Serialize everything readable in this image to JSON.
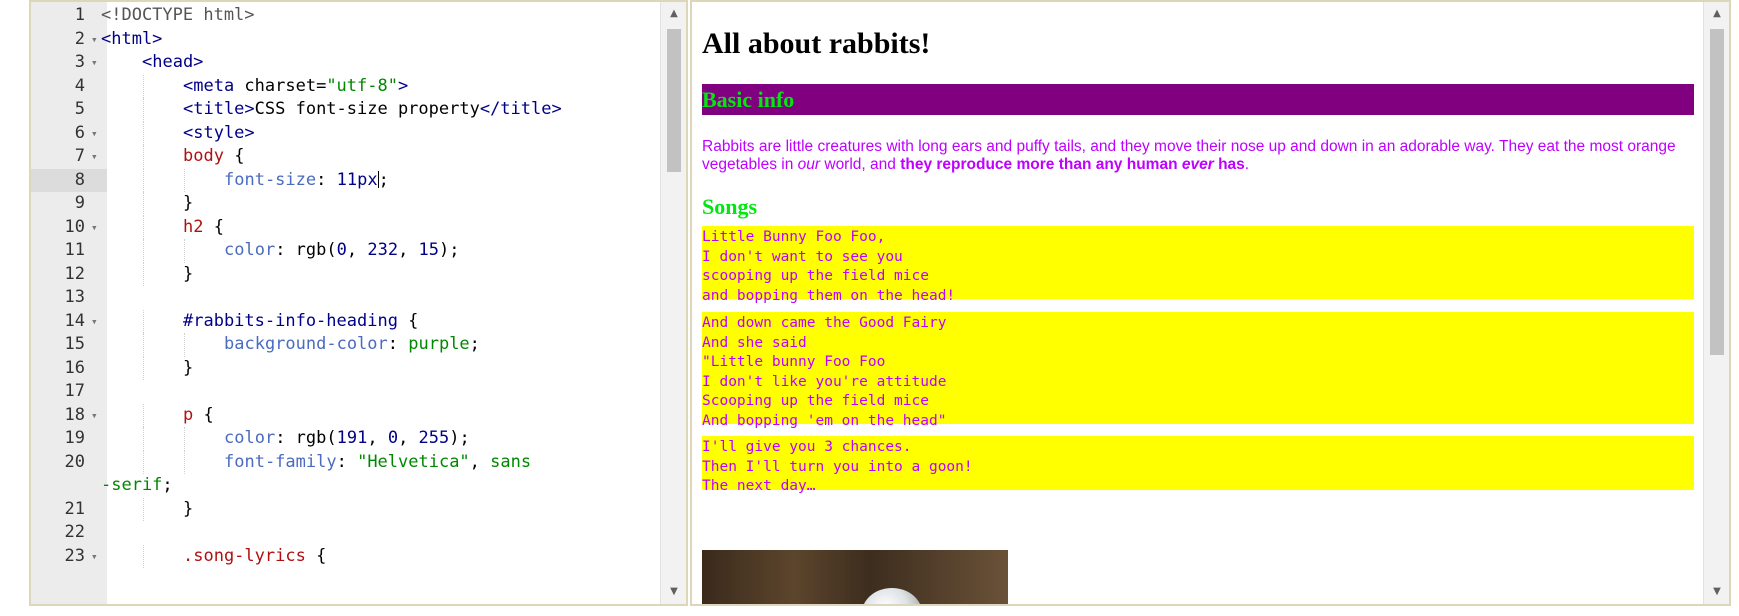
{
  "editor": {
    "active_line": 8,
    "lines": [
      {
        "n": "1",
        "fold": false,
        "indent": 0,
        "parts": [
          {
            "t": "<!DOCTYPE html>",
            "c": "doc"
          }
        ]
      },
      {
        "n": "2",
        "fold": true,
        "indent": 0,
        "parts": [
          {
            "t": "<html>",
            "c": "tag"
          }
        ]
      },
      {
        "n": "3",
        "fold": true,
        "indent": 1,
        "parts": [
          {
            "t": "<head>",
            "c": "tag"
          }
        ]
      },
      {
        "n": "4",
        "fold": false,
        "indent": 2,
        "parts": [
          {
            "t": "<meta ",
            "c": "tag"
          },
          {
            "t": "charset=",
            "c": "plain"
          },
          {
            "t": "\"utf-8\"",
            "c": "str"
          },
          {
            "t": ">",
            "c": "tag"
          }
        ]
      },
      {
        "n": "5",
        "fold": false,
        "indent": 2,
        "parts": [
          {
            "t": "<title>",
            "c": "tag"
          },
          {
            "t": "CSS font-size property",
            "c": "plain"
          },
          {
            "t": "</title>",
            "c": "tag"
          }
        ]
      },
      {
        "n": "6",
        "fold": true,
        "indent": 2,
        "parts": [
          {
            "t": "<style>",
            "c": "tag"
          }
        ]
      },
      {
        "n": "7",
        "fold": true,
        "indent": 2,
        "parts": [
          {
            "t": "body",
            "c": "sel"
          },
          {
            "t": " {",
            "c": "plain"
          }
        ]
      },
      {
        "n": "8",
        "fold": false,
        "indent": 3,
        "parts": [
          {
            "t": "font-size",
            "c": "prop"
          },
          {
            "t": ": ",
            "c": "plain"
          },
          {
            "t": "11px",
            "c": "num"
          },
          {
            "t": "|caret",
            "c": "caret"
          },
          {
            "t": ";",
            "c": "plain"
          }
        ]
      },
      {
        "n": "9",
        "fold": false,
        "indent": 2,
        "parts": [
          {
            "t": "}",
            "c": "plain"
          }
        ]
      },
      {
        "n": "10",
        "fold": true,
        "indent": 2,
        "parts": [
          {
            "t": "h2",
            "c": "sel"
          },
          {
            "t": " {",
            "c": "plain"
          }
        ]
      },
      {
        "n": "11",
        "fold": false,
        "indent": 3,
        "parts": [
          {
            "t": "color",
            "c": "prop"
          },
          {
            "t": ": rgb(",
            "c": "plain"
          },
          {
            "t": "0",
            "c": "num"
          },
          {
            "t": ", ",
            "c": "plain"
          },
          {
            "t": "232",
            "c": "num"
          },
          {
            "t": ", ",
            "c": "plain"
          },
          {
            "t": "15",
            "c": "num"
          },
          {
            "t": ");",
            "c": "plain"
          }
        ]
      },
      {
        "n": "12",
        "fold": false,
        "indent": 2,
        "parts": [
          {
            "t": "}",
            "c": "plain"
          }
        ]
      },
      {
        "n": "13",
        "fold": false,
        "indent": 0,
        "parts": []
      },
      {
        "n": "14",
        "fold": true,
        "indent": 2,
        "parts": [
          {
            "t": "#rabbits-info-heading",
            "c": "id"
          },
          {
            "t": " {",
            "c": "plain"
          }
        ]
      },
      {
        "n": "15",
        "fold": false,
        "indent": 3,
        "parts": [
          {
            "t": "background-color",
            "c": "prop"
          },
          {
            "t": ": ",
            "c": "plain"
          },
          {
            "t": "purple",
            "c": "str"
          },
          {
            "t": ";",
            "c": "plain"
          }
        ]
      },
      {
        "n": "16",
        "fold": false,
        "indent": 2,
        "parts": [
          {
            "t": "}",
            "c": "plain"
          }
        ]
      },
      {
        "n": "17",
        "fold": false,
        "indent": 0,
        "parts": []
      },
      {
        "n": "18",
        "fold": true,
        "indent": 2,
        "parts": [
          {
            "t": "p",
            "c": "sel"
          },
          {
            "t": " {",
            "c": "plain"
          }
        ]
      },
      {
        "n": "19",
        "fold": false,
        "indent": 3,
        "parts": [
          {
            "t": "color",
            "c": "prop"
          },
          {
            "t": ": rgb(",
            "c": "plain"
          },
          {
            "t": "191",
            "c": "num"
          },
          {
            "t": ", ",
            "c": "plain"
          },
          {
            "t": "0",
            "c": "num"
          },
          {
            "t": ", ",
            "c": "plain"
          },
          {
            "t": "255",
            "c": "num"
          },
          {
            "t": ");",
            "c": "plain"
          }
        ]
      },
      {
        "n": "20",
        "fold": false,
        "indent": 3,
        "parts": [
          {
            "t": "font-family",
            "c": "prop"
          },
          {
            "t": ": ",
            "c": "plain"
          },
          {
            "t": "\"Helvetica\"",
            "c": "str"
          },
          {
            "t": ", ",
            "c": "plain"
          },
          {
            "t": "sans",
            "c": "str"
          }
        ]
      },
      {
        "n": "",
        "fold": false,
        "indent": 0,
        "parts": [
          {
            "t": "-serif",
            "c": "str"
          },
          {
            "t": ";",
            "c": "plain"
          }
        ]
      },
      {
        "n": "21",
        "fold": false,
        "indent": 2,
        "parts": [
          {
            "t": "}",
            "c": "plain"
          }
        ]
      },
      {
        "n": "22",
        "fold": false,
        "indent": 0,
        "parts": []
      },
      {
        "n": "23",
        "fold": true,
        "indent": 2,
        "parts": [
          {
            "t": ".song-lyrics",
            "c": "sel"
          },
          {
            "t": " {",
            "c": "plain"
          }
        ]
      }
    ]
  },
  "preview": {
    "h1": "All about rabbits!",
    "basic_info": "Basic info",
    "para": {
      "p1": "Rabbits are little creatures with long ears and puffy tails, and they move their nose up and down in an adorable way. They eat the most orange vegetables in ",
      "p2": "our",
      "p3": " world, and ",
      "p4": "they reproduce more than any human ",
      "p5": "ever",
      "p6": " has",
      "p7": "."
    },
    "songs": "Songs",
    "lyrics": [
      "Little Bunny Foo Foo,\nI don't want to see you\nscooping up the field mice\nand bopping them on the head!",
      "And down came the Good Fairy\nAnd she said\n\"Little bunny Foo Foo\nI don't like you're attitude\nScooping up the field mice\nAnd bopping 'em on the head\"",
      "I'll give you 3 chances.\nThen I'll turn you into a goon!\nThe next day…"
    ]
  },
  "colors": {
    "h2_green": "#00e80f",
    "purple": "#800080",
    "p_color": "#bf00ff",
    "lyric_bg": "#ffff00",
    "pane_border": "#ddd6b8"
  },
  "icons": {
    "fold": "chevron-down-icon",
    "scroll_up": "scroll-up-arrow-icon",
    "scroll_down": "scroll-down-arrow-icon"
  }
}
